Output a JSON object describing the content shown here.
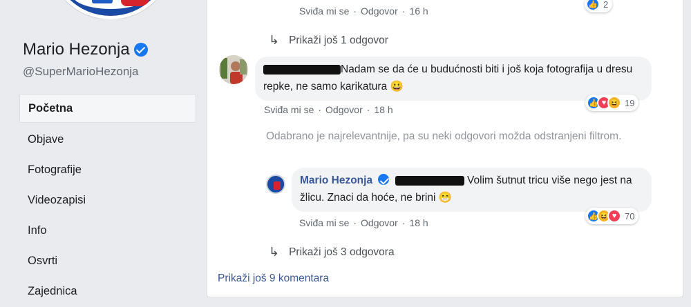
{
  "colors": {
    "accent": "#1877f2",
    "link": "#385898",
    "muted": "#606770",
    "bg": "#e9ebee"
  },
  "sidebar": {
    "page_name": "Mario Hezonja",
    "handle": "@SuperMarioHezonja",
    "items": [
      {
        "label": "Početna",
        "active": true
      },
      {
        "label": "Objave"
      },
      {
        "label": "Fotografije"
      },
      {
        "label": "Videozapisi"
      },
      {
        "label": "Info"
      },
      {
        "label": "Osvrti"
      },
      {
        "label": "Zajednica"
      }
    ]
  },
  "comments": {
    "top_reply": {
      "like": "Sviđa mi se",
      "reply": "Odgovor",
      "time": "16 h",
      "reaction_count": "2"
    },
    "show_more_reply_1": "Prikaži još 1 odgovor",
    "comment_1": {
      "text": "Nadam se da će u budućnosti biti i još koja fotografija u dresu repke, ne samo karikatura 😀",
      "like": "Sviđa mi se",
      "reply": "Odgovor",
      "time": "18 h",
      "reaction_count": "19"
    },
    "filter_notice": "Odabrano je najrelevantnije, pa su neki odgovori možda odstranjeni filtrom.",
    "reply_1": {
      "author": "Mario Hezonja",
      "text": "Volim šutnut tricu više nego jest na žlicu. Znaci da hoće, ne brini 😁",
      "like": "Sviđa mi se",
      "reply": "Odgovor",
      "time": "18 h",
      "reaction_count": "70"
    },
    "show_more_replies_3": "Prikaži još 3 odgovora",
    "show_more_comments": "Prikaži još 9 komentara"
  },
  "icons": {
    "verified": "verified-badge-icon",
    "reply_arrow": "reply-arrow-icon",
    "like": "like-reaction-icon",
    "love": "love-reaction-icon",
    "haha": "haha-reaction-icon"
  }
}
